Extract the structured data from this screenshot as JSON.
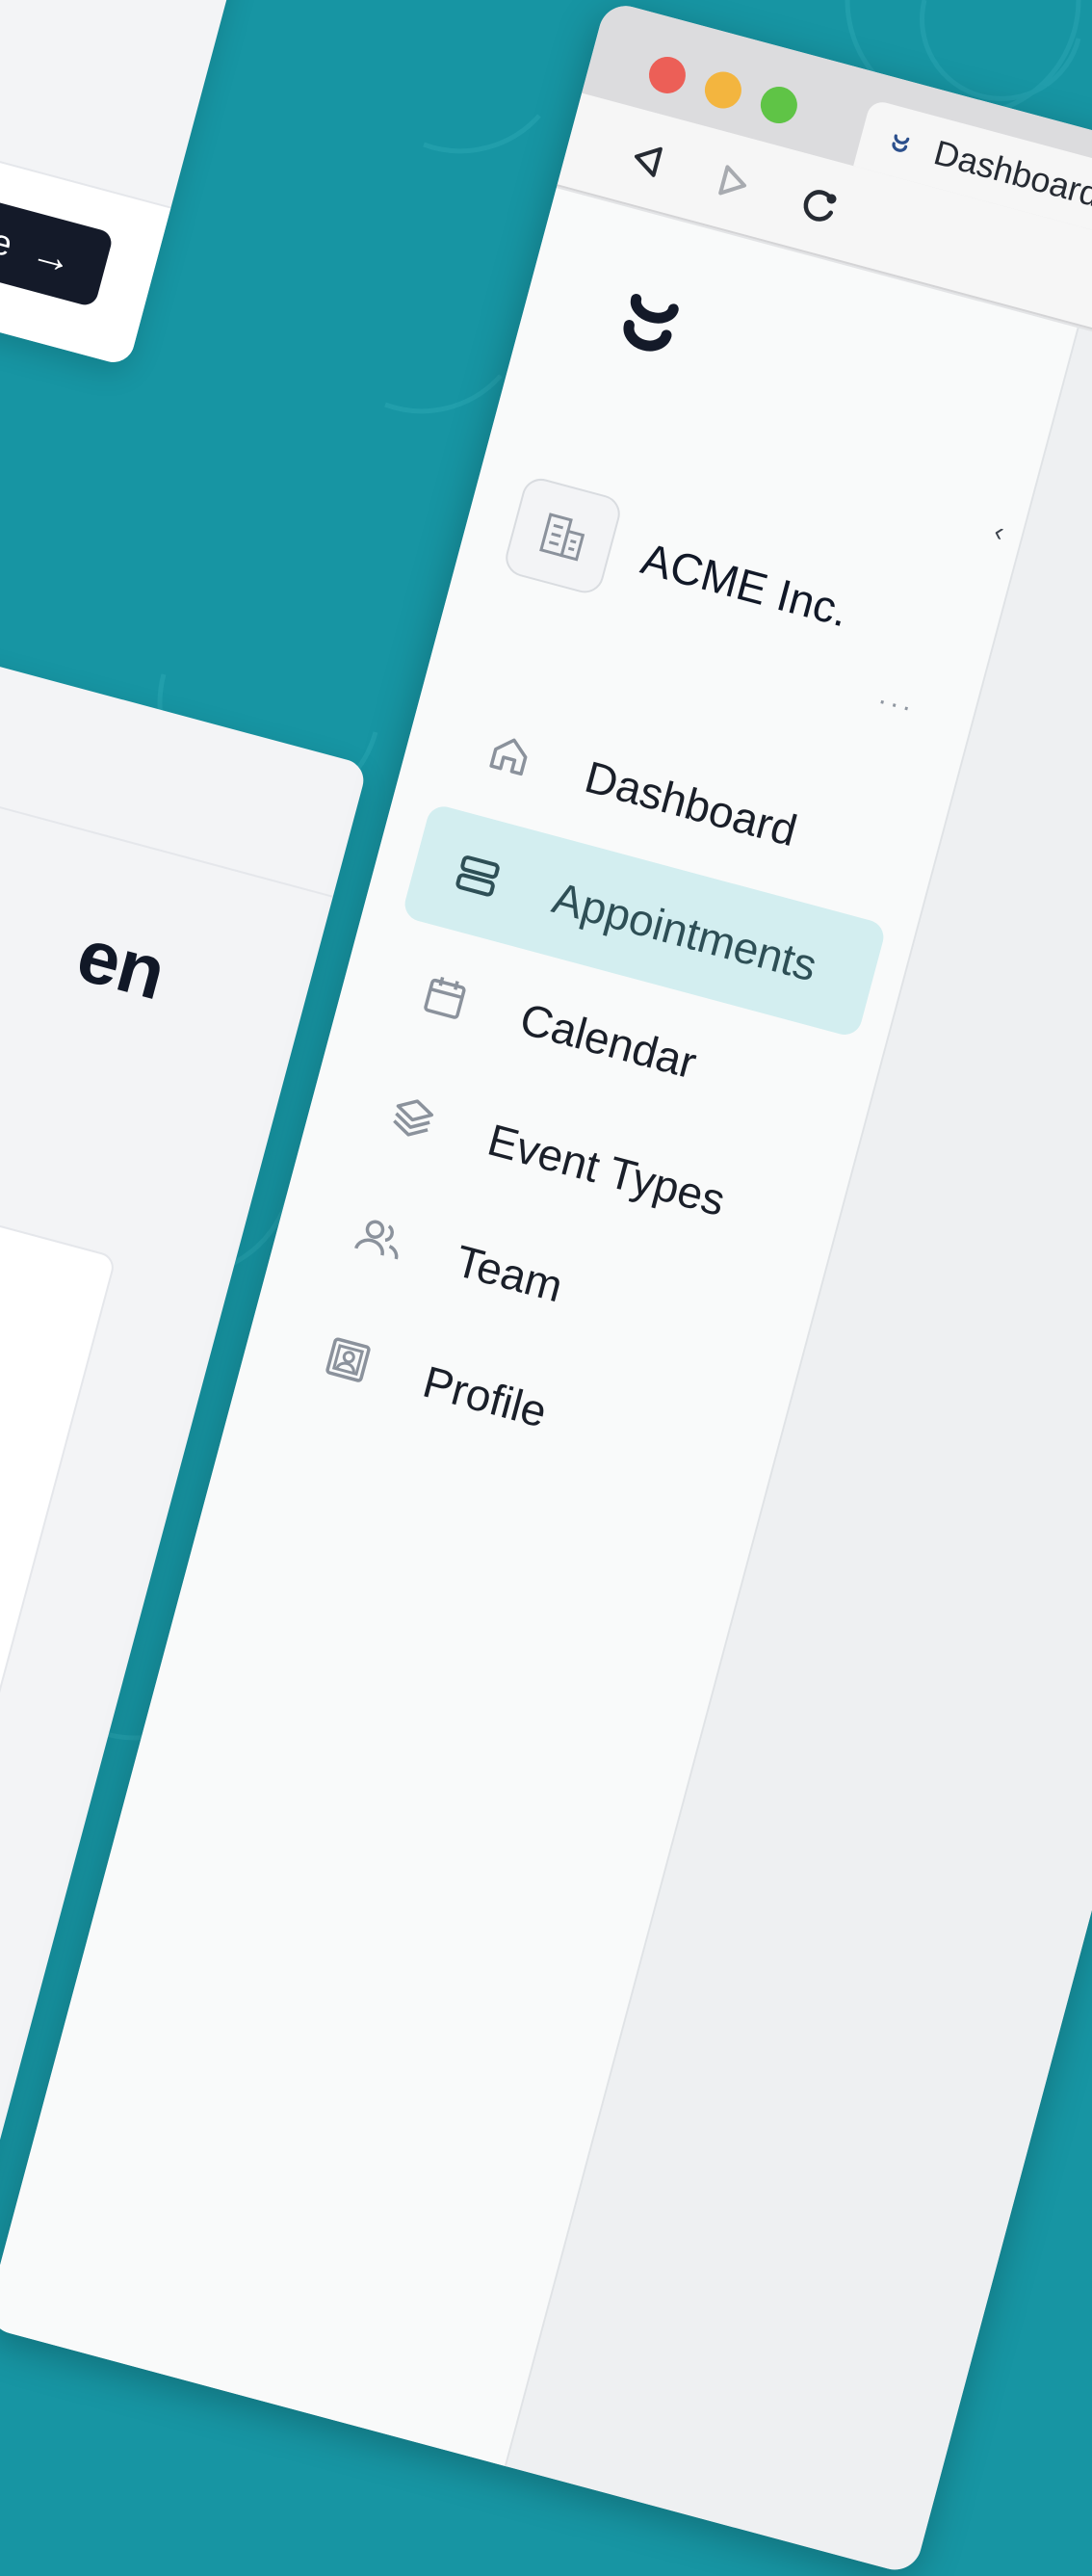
{
  "wizard": {
    "next_label": "Volgende",
    "next_arrow": "→"
  },
  "section": {
    "heading": "en"
  },
  "browser": {
    "tab_title": "Dashboard",
    "nav_back": "back",
    "nav_forward": "forward",
    "nav_reload": "reload"
  },
  "sidebar": {
    "org_name": "ACME Inc.",
    "org_more": "···",
    "collapse": "‹",
    "items": [
      {
        "label": "Dashboard",
        "icon": "home-icon",
        "active": false
      },
      {
        "label": "Appointments",
        "icon": "list-icon",
        "active": true
      },
      {
        "label": "Calendar",
        "icon": "calendar-icon",
        "active": false
      },
      {
        "label": "Event Types",
        "icon": "layers-icon",
        "active": false
      },
      {
        "label": "Team",
        "icon": "users-icon",
        "active": false
      },
      {
        "label": "Profile",
        "icon": "id-card-icon",
        "active": false
      }
    ]
  },
  "colors": {
    "background": "#1795a3",
    "active_item": "#d3eef0",
    "button_dark": "#141a29"
  }
}
